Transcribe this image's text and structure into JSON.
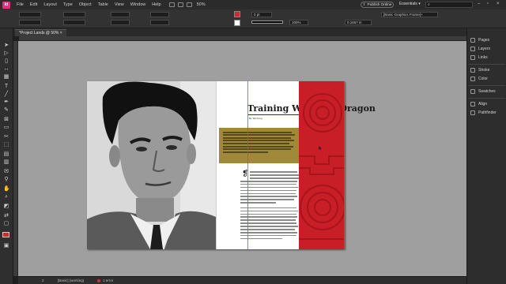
{
  "menubar": {
    "app_logo": "Id",
    "items": [
      "File",
      "Edit",
      "Layout",
      "Type",
      "Object",
      "Table",
      "View",
      "Window",
      "Help"
    ],
    "zoom": "50%",
    "publish_label": "Publish Online",
    "workspace": "Essentials",
    "search_placeholder": ""
  },
  "controlbar": {
    "x_field": "",
    "stroke_weight": "0 pt",
    "opacity": "100%",
    "dimension_value": "0.1667 in",
    "frame_style": "[Basic Graphics Frame]+",
    "fill_color": "#d22a2a",
    "stroke_color": "#000000"
  },
  "document": {
    "tab_label": "*Project Lands @ 50%",
    "title": "Training With The Dragon",
    "byline": "By Tell Kong"
  },
  "right_panels": [
    {
      "label": "Pages",
      "icon": "pages-icon"
    },
    {
      "label": "Layers",
      "icon": "layers-icon"
    },
    {
      "label": "Links",
      "icon": "links-icon"
    },
    {
      "label": "Stroke",
      "icon": "stroke-icon"
    },
    {
      "label": "Color",
      "icon": "color-icon"
    },
    {
      "label": "Swatches",
      "icon": "swatches-icon"
    },
    {
      "label": "Align",
      "icon": "align-icon"
    },
    {
      "label": "Pathfinder",
      "icon": "pathfinder-icon"
    }
  ],
  "statusbar": {
    "page": "2",
    "master": "[Basic] (working)",
    "errors": "1 error"
  },
  "colors": {
    "accent_red": "#c81e27",
    "gold": "#a08a3a",
    "app_brand": "#e0317f"
  }
}
